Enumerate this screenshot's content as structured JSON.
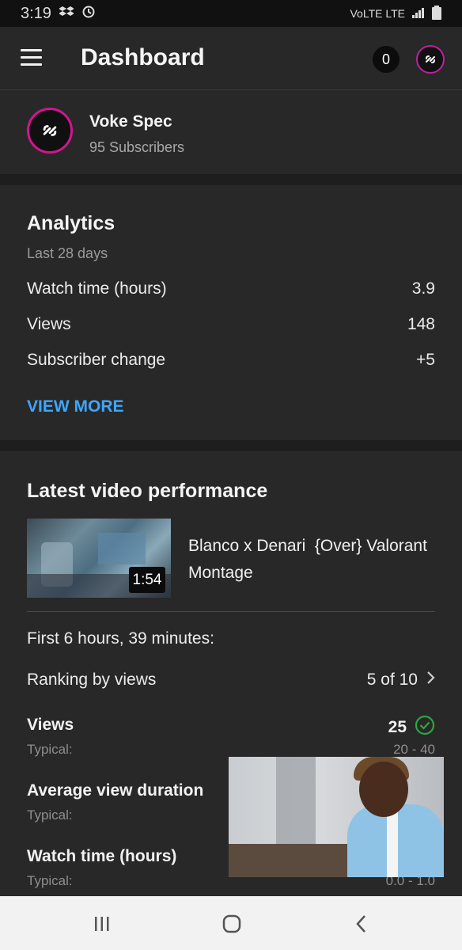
{
  "status_bar": {
    "time": "3:19",
    "network": "VoLTE LTE"
  },
  "header": {
    "title": "Dashboard",
    "notification_count": "0"
  },
  "channel": {
    "name": "Voke Spec",
    "subscribers": "95 Subscribers"
  },
  "analytics": {
    "title": "Analytics",
    "period": "Last 28 days",
    "metrics": [
      {
        "label": "Watch time (hours)",
        "value": "3.9"
      },
      {
        "label": "Views",
        "value": "148"
      },
      {
        "label": "Subscriber change",
        "value": "+5"
      }
    ],
    "view_more": "VIEW MORE"
  },
  "latest_video": {
    "title": "Latest video performance",
    "video_title": "Blanco x Denari  {Over} Valorant Montage",
    "duration": "1:54",
    "timeframe": "First 6 hours, 39 minutes:",
    "ranking_label": "Ranking by views",
    "ranking_value": "5 of 10",
    "stats": [
      {
        "label": "Views",
        "value": "25",
        "typical_label": "Typical:",
        "typical_range": "20 - 40"
      },
      {
        "label": "Average view duration",
        "value": "",
        "typical_label": "Typical:",
        "typical_range": ""
      },
      {
        "label": "Watch time (hours)",
        "value": "",
        "typical_label": "Typical:",
        "typical_range": "0.0 - 1.0"
      }
    ]
  },
  "colors": {
    "accent_link": "#3ea6ff",
    "avatar_ring": "#d4148f",
    "check_green": "#2ba640"
  }
}
